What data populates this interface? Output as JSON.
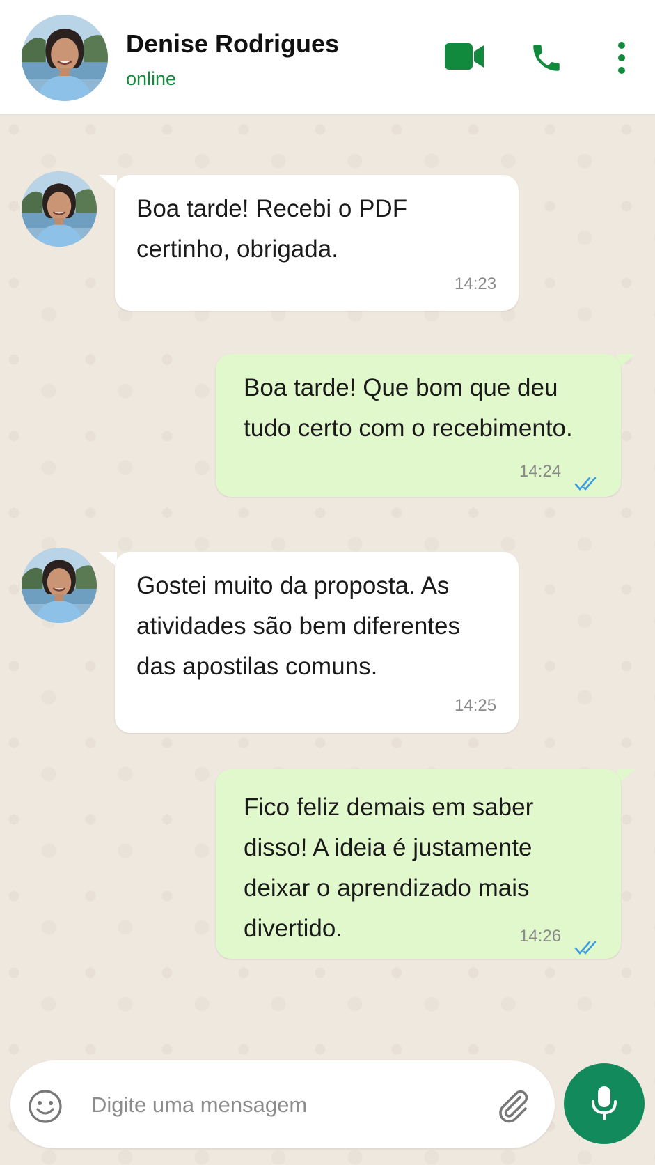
{
  "header": {
    "contact_name": "Denise Rodrigues",
    "status": "online",
    "icons": [
      "video-call-icon",
      "voice-call-icon",
      "more-options-icon"
    ]
  },
  "messages": [
    {
      "direction": "incoming",
      "text": "Boa tarde! Recebi o PDF\ncertinho, obrigada.",
      "time": "14:23"
    },
    {
      "direction": "outgoing",
      "text": "Boa tarde! Que bom que deu\ntudo certo com o recebimento.",
      "time": "14:24",
      "status": "read"
    },
    {
      "direction": "incoming",
      "text": "Gostei muito da proposta. As\natividades são bem diferentes\ndas apostilas comuns.",
      "time": "14:25"
    },
    {
      "direction": "outgoing",
      "text": "Fico feliz demais em saber\ndisso! A ideia é justamente\ndeixar o aprendizado mais\ndivertido.",
      "time": "14:26",
      "status": "read"
    }
  ],
  "composer": {
    "placeholder": "Digite uma mensagem",
    "value": "",
    "icons": [
      "emoji-icon",
      "attachment-icon",
      "microphone-icon"
    ]
  },
  "colors": {
    "accent_green": "#128a5c",
    "status_green": "#138a3e",
    "outgoing_bubble": "#e1f8cd",
    "incoming_bubble": "#ffffff",
    "read_tick_blue": "#3b9ae1",
    "chat_background": "#efe8df"
  }
}
